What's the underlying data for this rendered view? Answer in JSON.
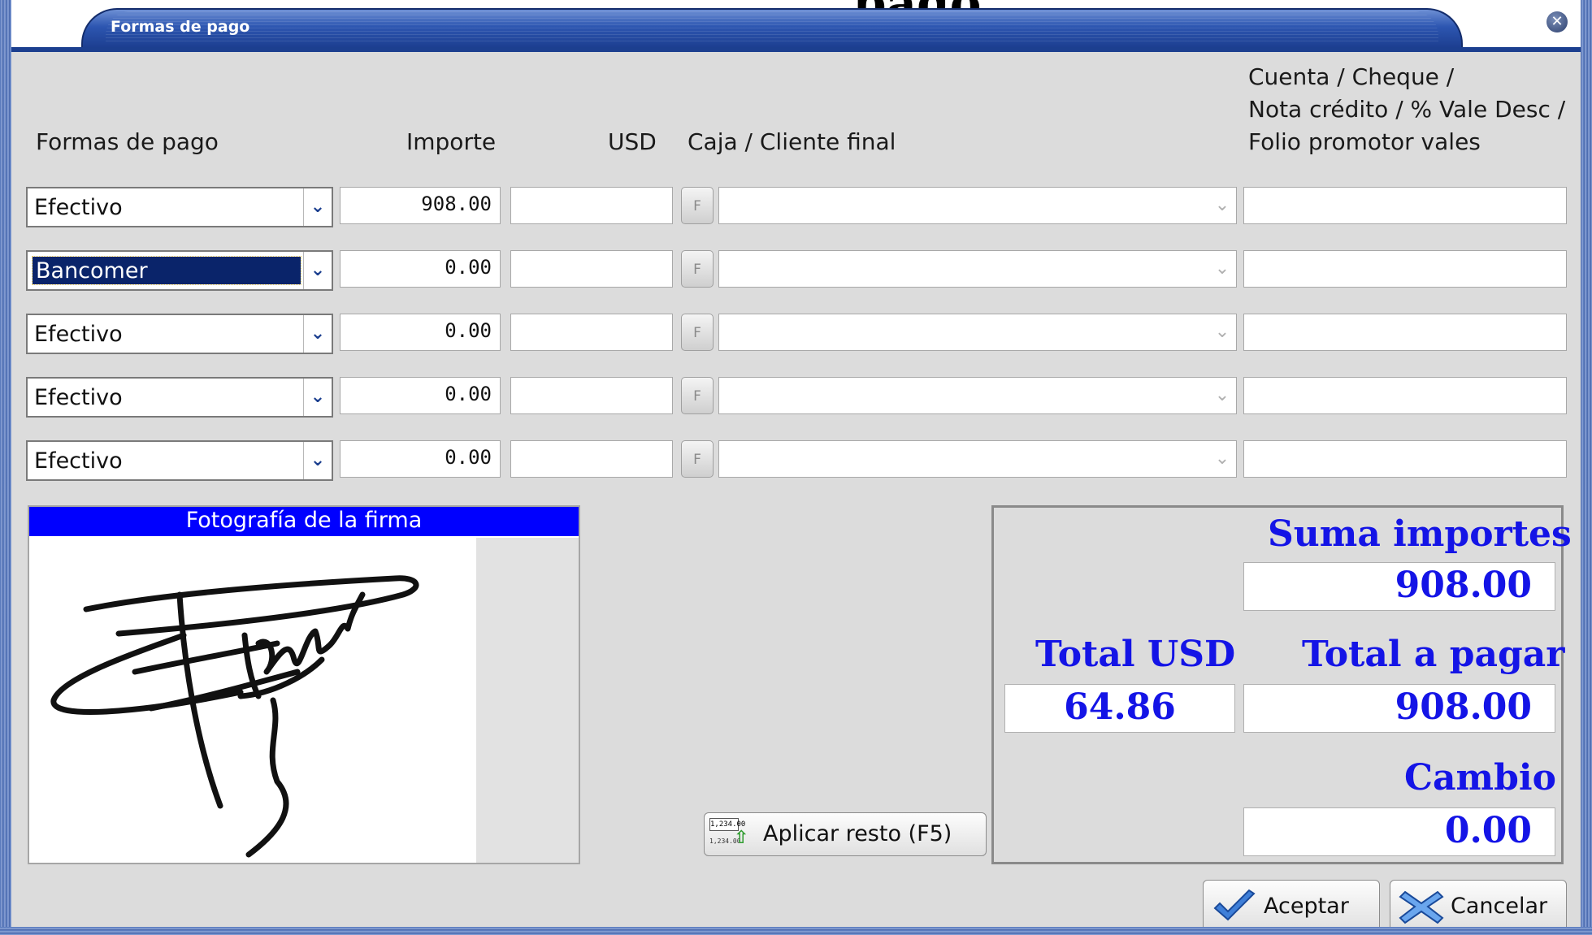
{
  "window": {
    "title": "Formas de pago",
    "ghost_title": "pago"
  },
  "headers": {
    "forma": "Formas de pago",
    "importe": "Importe",
    "usd": "USD",
    "caja": "Caja / Cliente final",
    "cuenta_1": "Cuenta / Cheque /",
    "cuenta_2": "Nota crédito / % Vale Desc /",
    "cuenta_3": "Folio promotor vales"
  },
  "rows": [
    {
      "forma": "Efectivo",
      "importe": "908.00",
      "usd": "",
      "f_label": "F",
      "caja": "",
      "cuenta": ""
    },
    {
      "forma": "Bancomer",
      "importe": "0.00",
      "usd": "",
      "f_label": "F",
      "caja": "",
      "cuenta": ""
    },
    {
      "forma": "Efectivo",
      "importe": "0.00",
      "usd": "",
      "f_label": "F",
      "caja": "",
      "cuenta": ""
    },
    {
      "forma": "Efectivo",
      "importe": "0.00",
      "usd": "",
      "f_label": "F",
      "caja": "",
      "cuenta": ""
    },
    {
      "forma": "Efectivo",
      "importe": "0.00",
      "usd": "",
      "f_label": "F",
      "caja": "",
      "cuenta": ""
    }
  ],
  "signature": {
    "title": "Fotografía de la firma"
  },
  "totals": {
    "suma_label": "Suma importes",
    "suma_value": "908.00",
    "usd_label": "Total USD",
    "usd_value": "64.86",
    "total_label": "Total a pagar",
    "total_value": "908.00",
    "cambio_label": "Cambio",
    "cambio_value": "0.00"
  },
  "buttons": {
    "aplicar": "Aplicar resto (F5)",
    "aplicar_icon_top": "1,234.00",
    "aplicar_icon_bottom": "1,234.00",
    "aceptar": "Aceptar",
    "cancelar": "Cancelar"
  },
  "icons": {
    "dropdown": "chevron-down-icon",
    "close": "close-icon",
    "accept": "check-icon",
    "cancel": "x-icon"
  },
  "colors": {
    "accent_blue": "#1414e6",
    "title_blue": "#2d56b1",
    "signature_bar": "#0000ff",
    "selection": "#0a246a"
  }
}
